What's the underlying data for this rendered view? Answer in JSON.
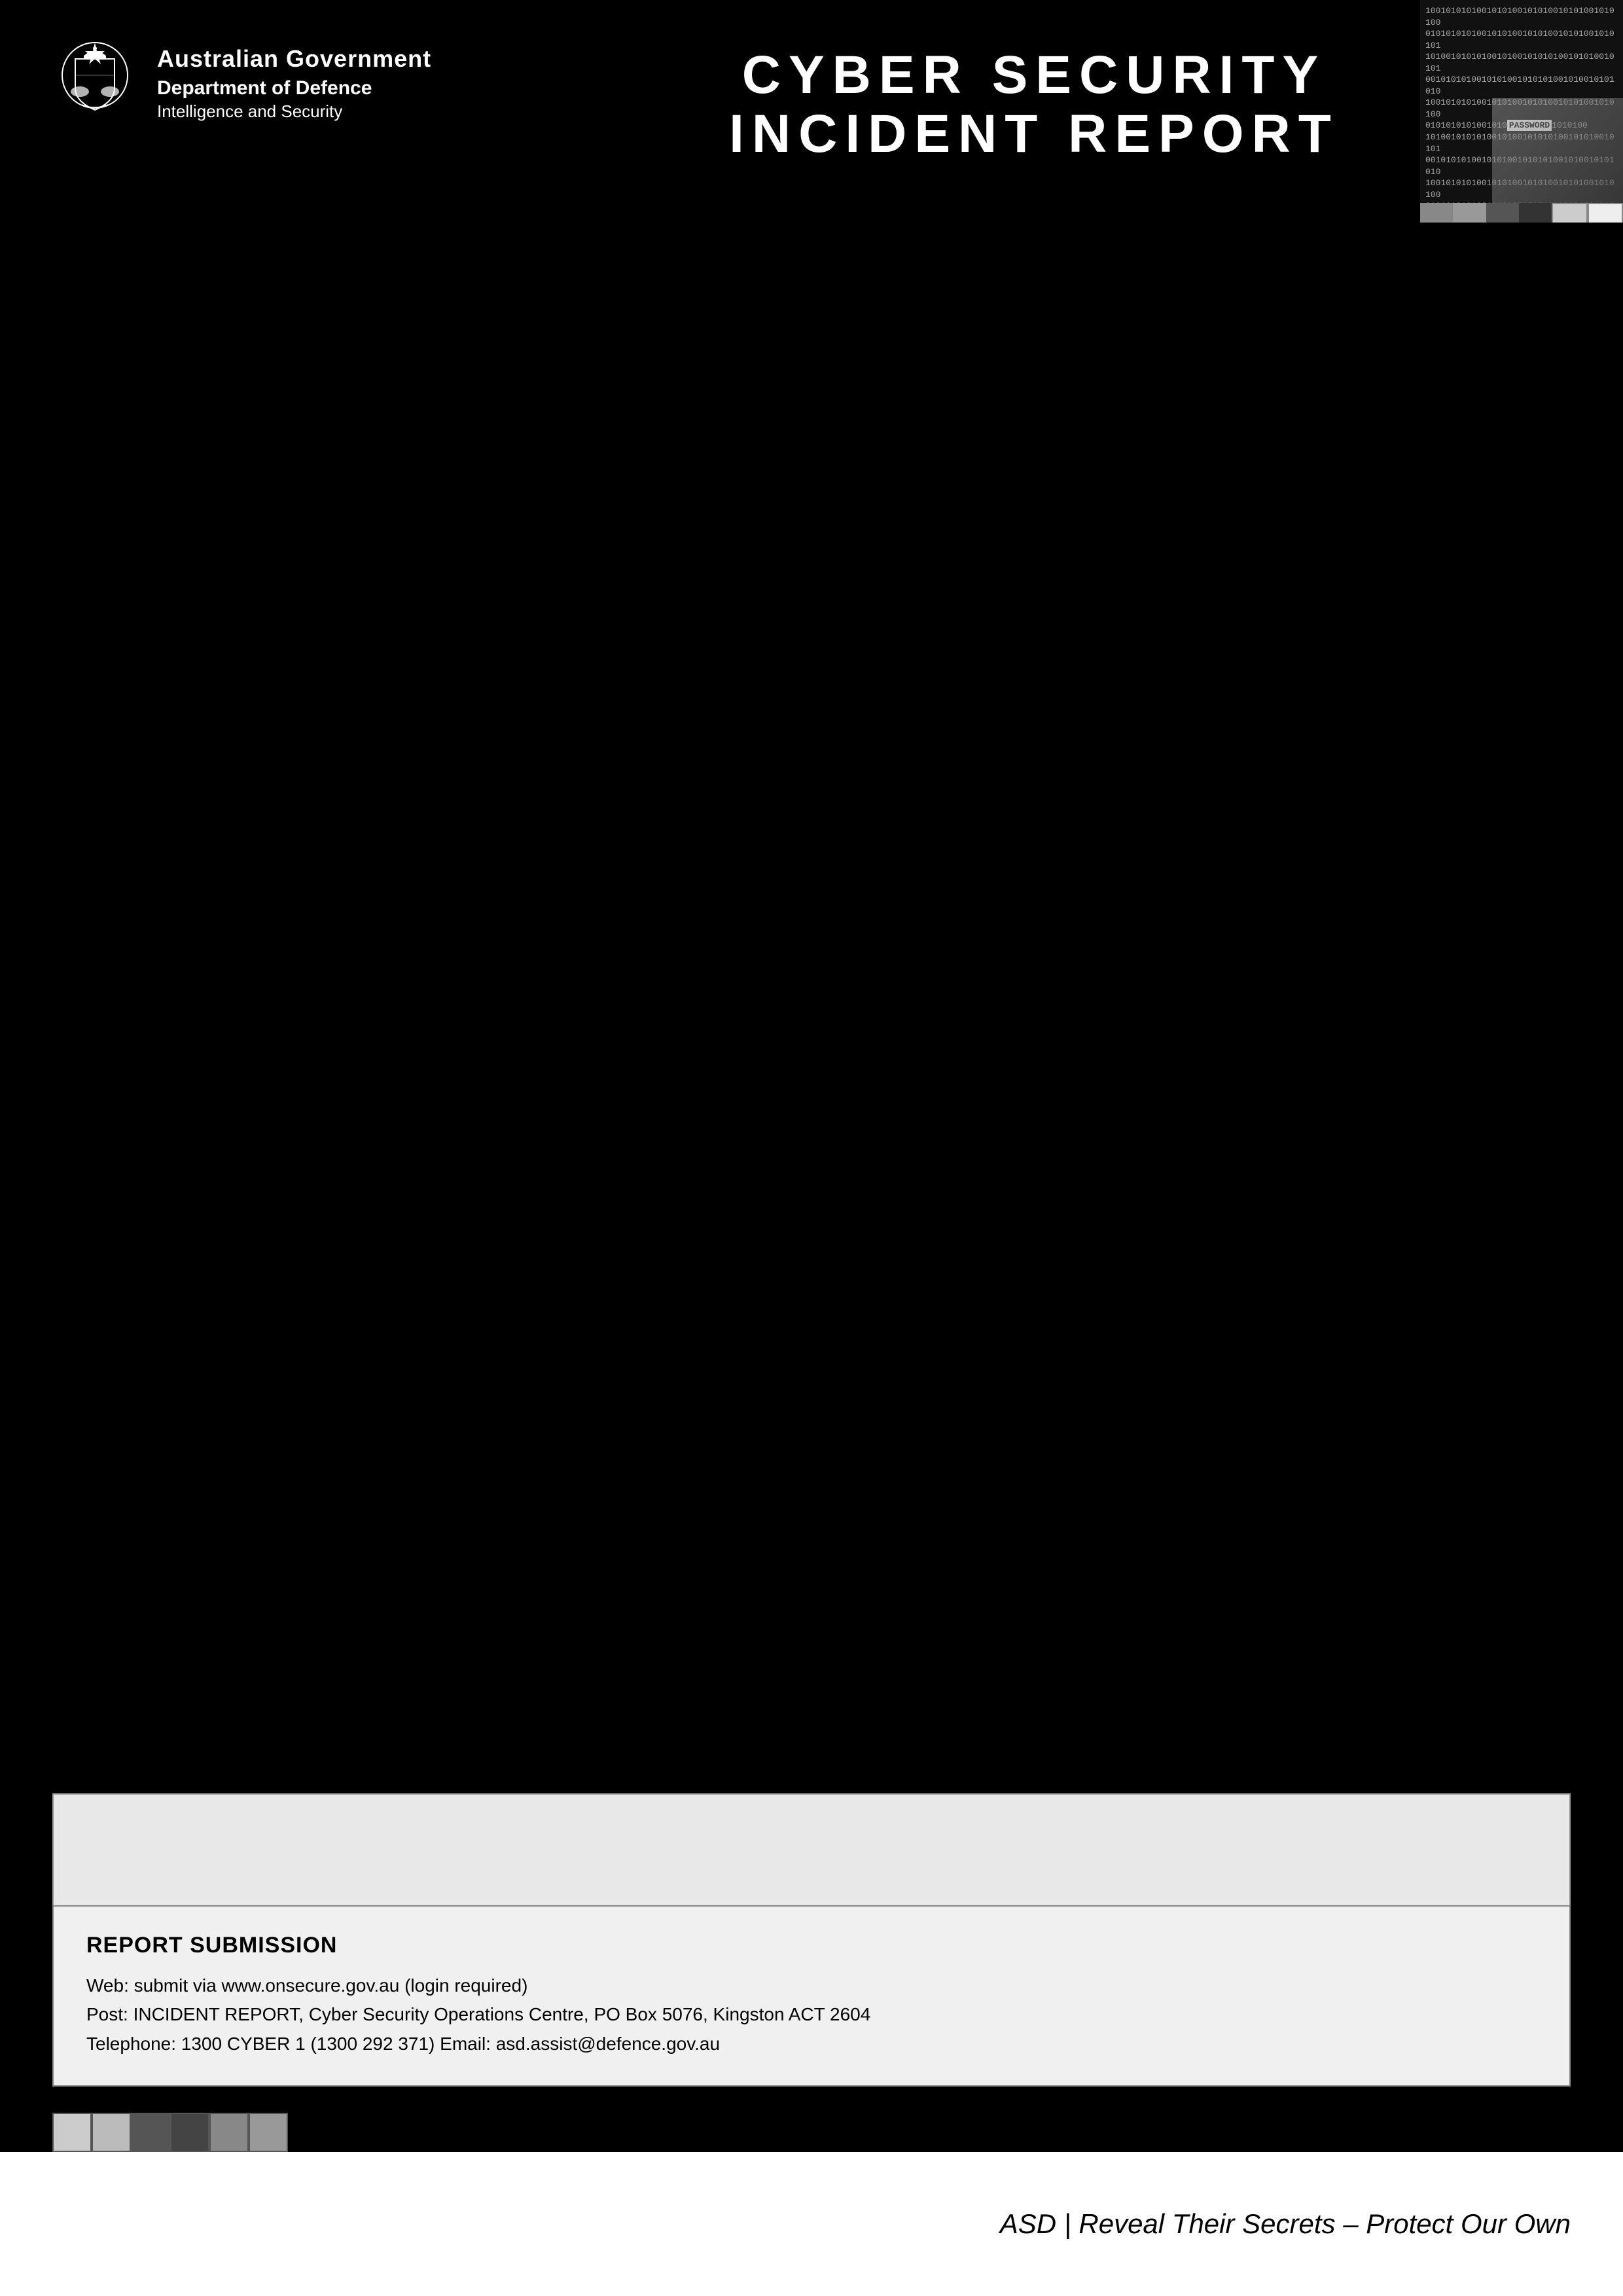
{
  "header": {
    "gov_line1": "Australian Government",
    "gov_line2": "Department of Defence",
    "gov_line3": "Intelligence and Security",
    "title_line1": "CYBER SECURITY",
    "title_line2": "INCIDENT REPORT"
  },
  "header_image": {
    "binary_text": "10010110101010010101001010100101001010100101010010100101010010101001010010101010010100101010101001010010101010010101001010101001010010101010010101001010010101",
    "password_text": "PASSWORD"
  },
  "color_bars_top": [
    {
      "color": "#888888",
      "label": "gray1"
    },
    {
      "color": "#999999",
      "label": "gray2"
    },
    {
      "color": "#555555",
      "label": "gray3"
    },
    {
      "color": "#333333",
      "label": "dark1"
    },
    {
      "color": "#cccccc",
      "label": "light1"
    },
    {
      "color": "#eeeeee",
      "label": "light2"
    }
  ],
  "color_bars_bottom": [
    {
      "color": "#cccccc",
      "label": "light1"
    },
    {
      "color": "#bbbbbb",
      "label": "light2"
    },
    {
      "color": "#555555",
      "label": "dark1"
    },
    {
      "color": "#444444",
      "label": "dark2"
    },
    {
      "color": "#888888",
      "label": "gray1"
    },
    {
      "color": "#999999",
      "label": "gray2"
    }
  ],
  "footer": {
    "report_submission_title": "REPORT SUBMISSION",
    "web_line": "Web: submit via www.onsecure.gov.au (login required)",
    "post_line": "Post: INCIDENT REPORT, Cyber Security Operations Centre, PO Box 5076, Kingston ACT 2604",
    "tel_line": "Telephone: 1300 CYBER 1 (1300 292 371)  Email: asd.assist@defence.gov.au",
    "tagline": "ASD | Reveal Their Secrets – Protect Our Own"
  }
}
